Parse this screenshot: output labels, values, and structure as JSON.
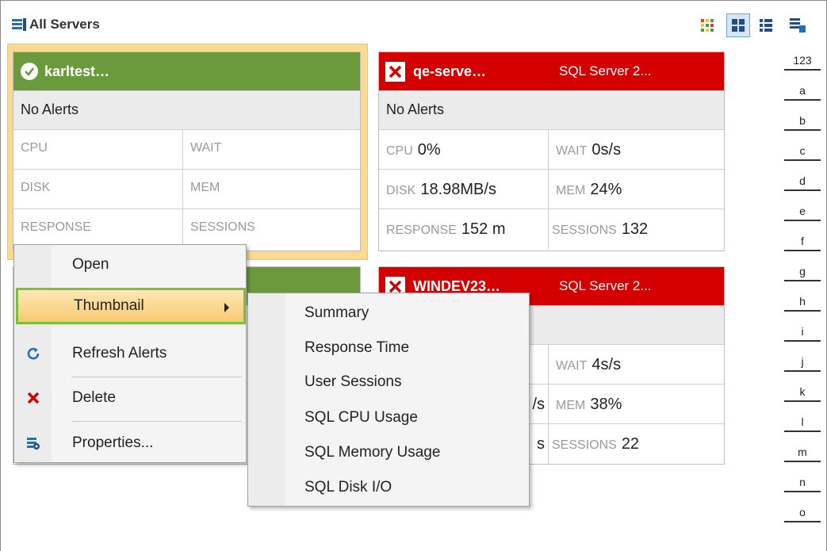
{
  "header": {
    "title": "All Servers",
    "view_buttons": [
      "heatmap-view",
      "thumbnail-view",
      "list-view",
      "server-list-view"
    ]
  },
  "cards": [
    {
      "name": "karltest…",
      "version": "",
      "status": "ok",
      "alerts": "No Alerts",
      "metrics": {
        "cpu_label": "CPU",
        "cpu_value": "",
        "wait_label": "WAIT",
        "wait_value": "",
        "disk_label": "DISK",
        "disk_value": "",
        "mem_label": "MEM",
        "mem_value": "",
        "response_label": "RESPONSE",
        "response_value": "",
        "sessions_label": "SESSIONS",
        "sessions_value": ""
      }
    },
    {
      "name": "qe-serve…",
      "version": "SQL Server 2...",
      "status": "error",
      "alerts": "No Alerts",
      "metrics": {
        "cpu_label": "CPU",
        "cpu_value": "0%",
        "wait_label": "WAIT",
        "wait_value": "0s/s",
        "disk_label": "DISK",
        "disk_value": "18.98MB/s",
        "mem_label": "MEM",
        "mem_value": "24%",
        "response_label": "RESPONSE",
        "response_value": "152 m",
        "sessions_label": "SESSIONS",
        "sessions_value": "132"
      }
    },
    {
      "name": "WINDEV23…",
      "version": "SQL Server 2...",
      "status": "error",
      "metrics": {
        "wait_label": "WAIT",
        "wait_value": "4s/s",
        "disk_partial": "/s",
        "mem_label": "MEM",
        "mem_value": "38%",
        "response_partial": "s",
        "sessions_label": "SESSIONS",
        "sessions_value": "22"
      }
    }
  ],
  "context_menu": {
    "items": [
      "Open",
      "Thumbnail",
      "Refresh Alerts",
      "Delete",
      "Properties..."
    ],
    "highlighted": "Thumbnail"
  },
  "submenu": {
    "items": [
      "Summary",
      "Response Time",
      "User Sessions",
      "SQL CPU Usage",
      "SQL Memory Usage",
      "SQL Disk I/O"
    ]
  },
  "alpha_index": [
    "123",
    "a",
    "b",
    "c",
    "d",
    "e",
    "f",
    "g",
    "h",
    "i",
    "j",
    "k",
    "l",
    "m",
    "n",
    "o"
  ],
  "colors": {
    "ok": "#6b9a3d",
    "error": "#d40000",
    "selected": "#fbd98e",
    "highlight_border": "#7bbf3c"
  }
}
